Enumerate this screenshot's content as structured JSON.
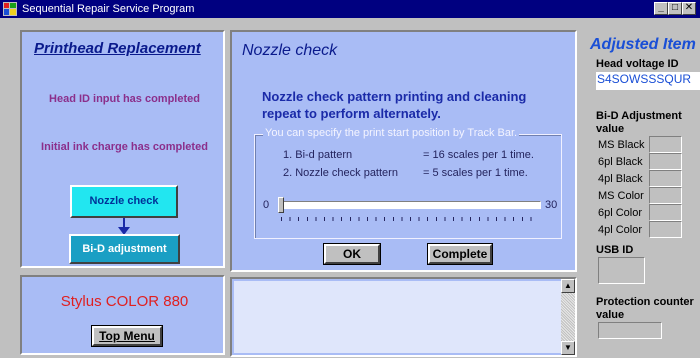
{
  "window": {
    "title": "Sequential Repair Service Program",
    "controls": [
      "_",
      "□",
      "✕"
    ]
  },
  "left_panel": {
    "heading": "Printhead Replacement",
    "messages": [
      "Head ID input has completed",
      "Initial ink charge has completed"
    ],
    "steps": {
      "nozzle_check": "Nozzle check",
      "bid_adjustment": "Bi-D adjustment"
    }
  },
  "model_panel": {
    "model_name": "Stylus COLOR 880",
    "top_menu_button": "Top Menu"
  },
  "center_panel": {
    "title": "Nozzle check",
    "instruction": "Nozzle check pattern printing and cleaning repeat to perform alternately.",
    "group_legend": "You can specify the print start position by Track Bar.",
    "patterns": [
      {
        "label": "1. Bi-d pattern",
        "value": "= 16 scales per 1 time."
      },
      {
        "label": "2. Nozzle check pattern",
        "value": "=  5 scales per 1 time."
      }
    ],
    "trackbar": {
      "min": "0",
      "max": "30",
      "value": 0
    },
    "ok_button": "OK",
    "complete_button": "Complete"
  },
  "log_panel": {
    "text": ""
  },
  "right_panel": {
    "heading": "Adjusted Item",
    "head_voltage_label": "Head voltage ID",
    "head_voltage_value": "S4SOWSSSQUR",
    "bid_label": "Bi-D Adjustment value",
    "bid_rows": [
      "MS Black",
      "6pl Black",
      "4pl Black",
      "MS Color",
      "6pl Color",
      "4pl Color"
    ],
    "usb_label": "USB ID",
    "protection_label": "Protection counter value"
  },
  "colors": {
    "titlebar": "#000080",
    "panel": "#a9bcf5",
    "accent_red": "#e02020",
    "nozzle_button": "#22e6f0",
    "bid_button": "#1a9fc4"
  }
}
